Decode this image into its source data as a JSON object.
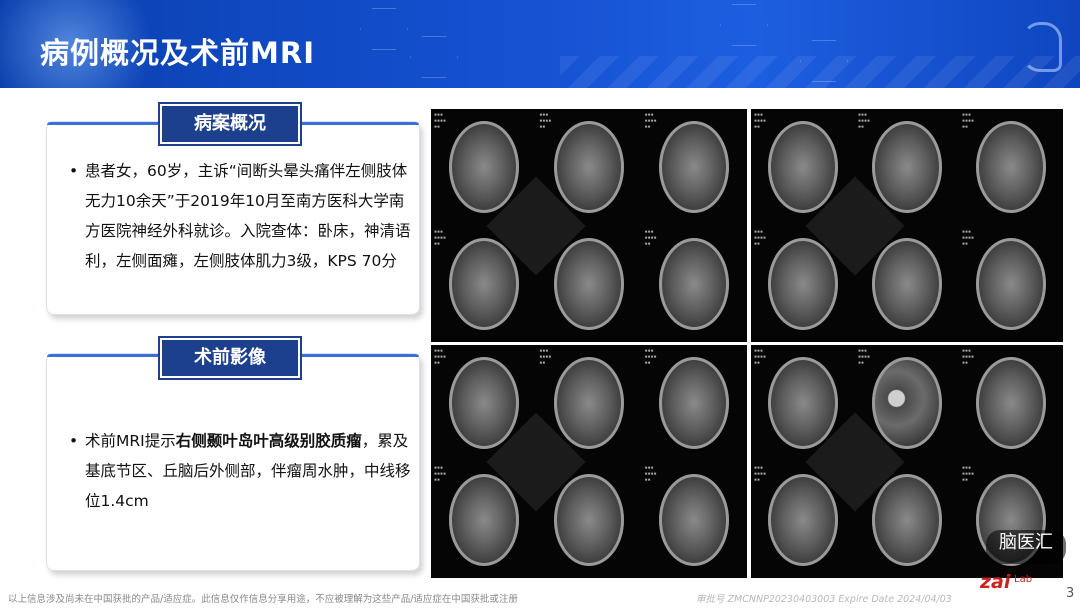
{
  "slide": {
    "title": "病例概况及术前MRI",
    "page_number": "3"
  },
  "case_overview": {
    "heading": "病案概况",
    "bullet": "患者女，60岁，主诉“间断头晕头痛伴左侧肢体无力10余天”于2019年10月至南方医科大学南方医院神经外科就诊。入院查体：卧床，神清语利，左侧面瘫，左侧肢体肌力3级，KPS 70分"
  },
  "preop_imaging": {
    "heading": "术前影像",
    "bullet_prefix": "术前MRI提示",
    "bullet_bold": "右侧颞叶岛叶高级别胶质瘤",
    "bullet_suffix": "，累及基底节区、丘脑后外侧部，伴瘤周水肿，中线移位1.4cm"
  },
  "mri_panels": [
    "MRI panel 1",
    "MRI panel 2",
    "MRI panel 3",
    "MRI panel 4"
  ],
  "footer": {
    "disclaimer": "以上信息涉及尚未在中国获批的产品/适应症。此信息仅作信息分享用途，不应被理解为这些产品/适应症在中国获批或注册",
    "approval": "审批号 ZMCNNP20230403003 Expire Date 2024/04/03",
    "brand": "zai",
    "brand_suffix": "Lab",
    "watermark": "脑医汇"
  },
  "colors": {
    "header_blue": "#1450d0",
    "tag_navy": "#1c3f8e",
    "brand_red": "#d0201f"
  }
}
